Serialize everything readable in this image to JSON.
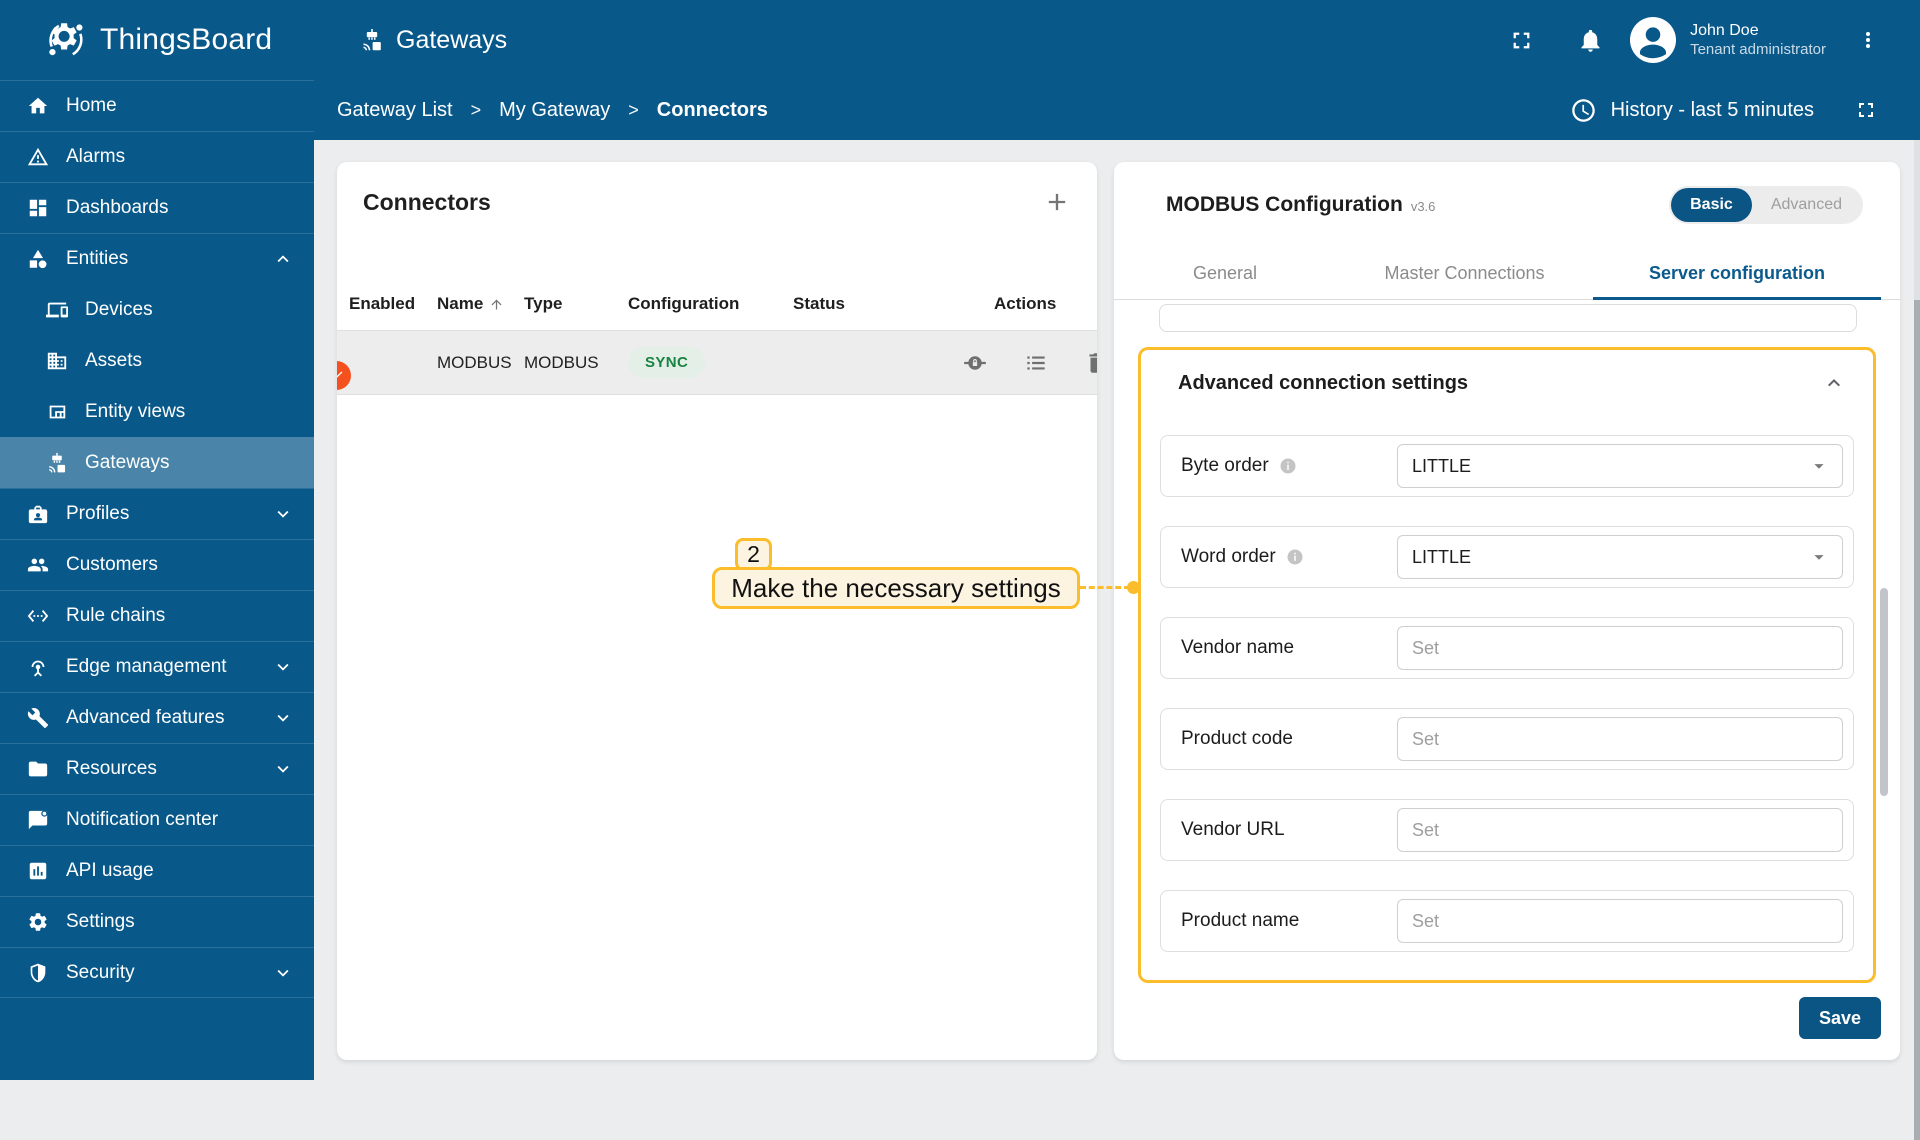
{
  "topbar": {
    "brand": "ThingsBoard",
    "page_title": "Gateways",
    "user": {
      "name": "John Doe",
      "role": "Tenant administrator"
    }
  },
  "subheader": {
    "breadcrumb": [
      "Gateway List",
      "My Gateway",
      "Connectors"
    ],
    "separator": ">",
    "history_label": "History - last 5 minutes"
  },
  "sidebar": {
    "items": [
      {
        "label": "Home",
        "icon": "home-icon"
      },
      {
        "label": "Alarms",
        "icon": "alarm-icon"
      },
      {
        "label": "Dashboards",
        "icon": "dashboards-icon"
      },
      {
        "label": "Entities",
        "icon": "entities-icon",
        "chevron": "up"
      },
      {
        "label": "Devices",
        "icon": "devices-icon",
        "indent": true
      },
      {
        "label": "Assets",
        "icon": "assets-icon",
        "indent": true
      },
      {
        "label": "Entity views",
        "icon": "entity-views-icon",
        "indent": true
      },
      {
        "label": "Gateways",
        "icon": "gateway-icon",
        "indent": true,
        "selected": true
      },
      {
        "label": "Profiles",
        "icon": "profiles-icon",
        "chevron": "down"
      },
      {
        "label": "Customers",
        "icon": "customers-icon"
      },
      {
        "label": "Rule chains",
        "icon": "rule-chains-icon"
      },
      {
        "label": "Edge management",
        "icon": "edge-icon",
        "chevron": "down"
      },
      {
        "label": "Advanced features",
        "icon": "advanced-features-icon",
        "chevron": "down"
      },
      {
        "label": "Resources",
        "icon": "resources-icon",
        "chevron": "down"
      },
      {
        "label": "Notification center",
        "icon": "notification-icon"
      },
      {
        "label": "API usage",
        "icon": "api-usage-icon"
      },
      {
        "label": "Settings",
        "icon": "settings-icon"
      },
      {
        "label": "Security",
        "icon": "security-icon",
        "chevron": "down"
      }
    ]
  },
  "connectors": {
    "title": "Connectors",
    "columns": [
      "Enabled",
      "Name",
      "Type",
      "Configuration",
      "Status",
      "Actions"
    ],
    "sorted_column": "Name",
    "rows": [
      {
        "enabled": true,
        "name": "MODBUS",
        "type": "MODBUS",
        "configuration": "SYNC",
        "status_ok": true
      }
    ],
    "row_action_icons": [
      "rpc-lock-icon",
      "logs-list-icon",
      "delete-icon"
    ]
  },
  "annotation": {
    "step": "2",
    "text": "Make the necessary settings"
  },
  "config_panel": {
    "title": "MODBUS Configuration",
    "version": "v3.6",
    "mode_toggle": [
      "Basic",
      "Advanced"
    ],
    "mode_selected": "Basic",
    "tabs": [
      "General",
      "Master Connections",
      "Server configuration"
    ],
    "active_tab": "Server configuration",
    "section": {
      "title": "Advanced connection settings",
      "fields": [
        {
          "label": "Byte order",
          "type": "select",
          "value": "LITTLE",
          "info": true
        },
        {
          "label": "Word order",
          "type": "select",
          "value": "LITTLE",
          "info": true
        },
        {
          "label": "Vendor name",
          "type": "text",
          "placeholder": "Set"
        },
        {
          "label": "Product code",
          "type": "text",
          "placeholder": "Set"
        },
        {
          "label": "Vendor URL",
          "type": "text",
          "placeholder": "Set"
        },
        {
          "label": "Product name",
          "type": "text",
          "placeholder": "Set"
        }
      ]
    },
    "save_label": "Save"
  },
  "colors": {
    "primary_blue": "#08588a",
    "highlight_yellow": "#fbbd2c",
    "annotation_fill": "#fcf3e0",
    "toggle_orange": "#f4511e",
    "chip_green_text": "#188342",
    "chip_green_bg": "#e4efe7",
    "status_green": "#0c8636",
    "save_button_blue": "#0a5584"
  }
}
